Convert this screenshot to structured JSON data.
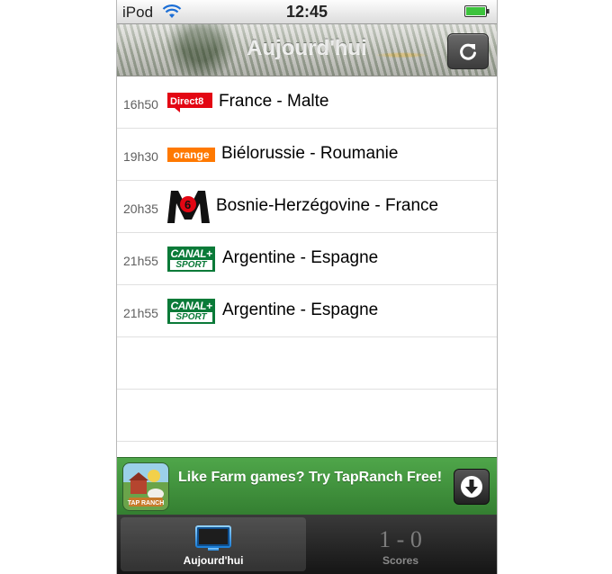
{
  "status_bar": {
    "carrier": "iPod",
    "time": "12:45",
    "icons": [
      "wifi-icon",
      "battery-icon"
    ]
  },
  "nav": {
    "title": "Aujourd'hui",
    "refresh_icon": "refresh-icon"
  },
  "matches": [
    {
      "time": "16h50",
      "channel_logo": "Direct 8",
      "channel_text": "Direct8",
      "teams": "France - Malte"
    },
    {
      "time": "19h30",
      "channel_logo": "orange",
      "channel_text": "orange",
      "teams": "Biélorussie - Roumanie"
    },
    {
      "time": "20h35",
      "channel_logo": "M6",
      "channel_text": "6",
      "teams": "Bosnie-Herzégovine - France"
    },
    {
      "time": "21h55",
      "channel_logo": "Canal+ Sport",
      "channel_text": "CANAL+",
      "channel_subtext": "SPORT",
      "teams": "Argentine - Espagne"
    },
    {
      "time": "21h55",
      "channel_logo": "Canal+ Sport",
      "channel_text": "CANAL+",
      "channel_subtext": "SPORT",
      "teams": "Argentine - Espagne"
    }
  ],
  "ad": {
    "text": "Like Farm games? Try TapRanch Free!",
    "thumb_text": "TAP RANCH",
    "download_icon": "download-icon"
  },
  "tabs": [
    {
      "label": "Aujourd'hui",
      "icon": "tv-icon",
      "active": true
    },
    {
      "label": "Scores",
      "icon_text": "1 - 0",
      "active": false
    }
  ],
  "colors": {
    "ad_green": "#3f9a3b",
    "canal_green": "#0a7a38",
    "orange": "#ff7900",
    "direct8_red": "#e30613"
  }
}
